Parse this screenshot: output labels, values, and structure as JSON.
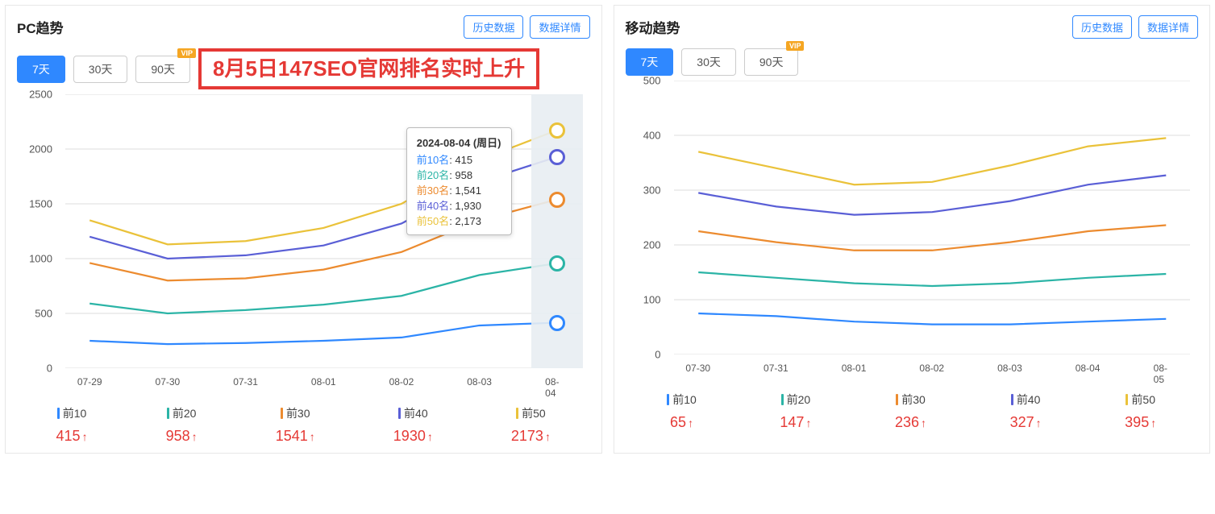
{
  "buttons": {
    "history": "历史数据",
    "detail": "数据详情"
  },
  "ranges": {
    "r7": "7天",
    "r30": "30天",
    "r90": "90天"
  },
  "series_meta": [
    {
      "key": "s10",
      "name": "前10",
      "label": "前10名",
      "color": "#2f88ff"
    },
    {
      "key": "s20",
      "name": "前20",
      "label": "前20名",
      "color": "#2bb4a6"
    },
    {
      "key": "s30",
      "name": "前30",
      "label": "前30名",
      "color": "#ec8b2f"
    },
    {
      "key": "s40",
      "name": "前40",
      "label": "前40名",
      "color": "#5a5fd6"
    },
    {
      "key": "s50",
      "name": "前50",
      "label": "前50名",
      "color": "#eac23a"
    }
  ],
  "pc": {
    "title": "PC趋势",
    "banner": "8月5日147SEO官网排名实时上升",
    "tooltip_title": "2024-08-04 (周日)",
    "tooltip_values": {
      "s10": "415",
      "s20": "958",
      "s30": "1,541",
      "s40": "1,930",
      "s50": "2,173"
    },
    "legend_values": {
      "s10": "415",
      "s20": "958",
      "s30": "1541",
      "s40": "1930",
      "s50": "2173"
    }
  },
  "mobile": {
    "title": "移动趋势",
    "legend_values": {
      "s10": "65",
      "s20": "147",
      "s30": "236",
      "s40": "327",
      "s50": "395"
    }
  },
  "chart_data": [
    {
      "type": "line",
      "panel": "pc",
      "title": "PC趋势",
      "xlabel": "",
      "ylabel": "",
      "ylim": [
        0,
        2500
      ],
      "yticks": [
        0,
        500,
        1000,
        1500,
        2000,
        2500
      ],
      "categories": [
        "07-29",
        "07-30",
        "07-31",
        "08-01",
        "08-02",
        "08-03",
        "08-04"
      ],
      "series": [
        {
          "name": "前10名",
          "color": "#2f88ff",
          "values": [
            250,
            220,
            230,
            250,
            280,
            390,
            415
          ]
        },
        {
          "name": "前20名",
          "color": "#2bb4a6",
          "values": [
            590,
            500,
            530,
            580,
            660,
            850,
            958
          ]
        },
        {
          "name": "前30名",
          "color": "#ec8b2f",
          "values": [
            960,
            800,
            820,
            900,
            1060,
            1350,
            1541
          ]
        },
        {
          "name": "前40名",
          "color": "#5a5fd6",
          "values": [
            1200,
            1000,
            1030,
            1120,
            1320,
            1700,
            1930
          ]
        },
        {
          "name": "前50名",
          "color": "#eac23a",
          "values": [
            1350,
            1130,
            1160,
            1280,
            1500,
            1900,
            2173
          ]
        }
      ],
      "tooltip": {
        "date": "2024-08-04 (周日)",
        "values": {
          "前10名": 415,
          "前20名": 958,
          "前30名": 1541,
          "前40名": 1930,
          "前50名": 2173
        }
      }
    },
    {
      "type": "line",
      "panel": "mobile",
      "title": "移动趋势",
      "xlabel": "",
      "ylabel": "",
      "ylim": [
        0,
        500
      ],
      "yticks": [
        0,
        100,
        200,
        300,
        400,
        500
      ],
      "categories": [
        "07-30",
        "07-31",
        "08-01",
        "08-02",
        "08-03",
        "08-04",
        "08-05"
      ],
      "series": [
        {
          "name": "前10名",
          "color": "#2f88ff",
          "values": [
            75,
            70,
            60,
            55,
            55,
            60,
            65
          ]
        },
        {
          "name": "前20名",
          "color": "#2bb4a6",
          "values": [
            150,
            140,
            130,
            125,
            130,
            140,
            147
          ]
        },
        {
          "name": "前30名",
          "color": "#ec8b2f",
          "values": [
            225,
            205,
            190,
            190,
            205,
            225,
            236
          ]
        },
        {
          "name": "前40名",
          "color": "#5a5fd6",
          "values": [
            295,
            270,
            255,
            260,
            280,
            310,
            327
          ]
        },
        {
          "name": "前50名",
          "color": "#eac23a",
          "values": [
            370,
            340,
            310,
            315,
            345,
            380,
            395
          ]
        }
      ]
    }
  ]
}
